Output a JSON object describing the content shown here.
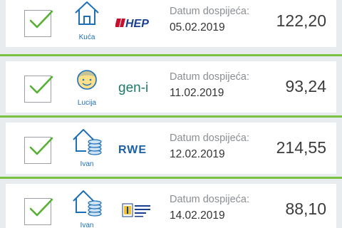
{
  "colors": {
    "divider": "#7cc242",
    "check": "#56b133",
    "accent_blue": "#1d6fb8",
    "hep_red": "#c8102e",
    "hep_blue": "#1b3f8f"
  },
  "bills": [
    {
      "category_icon": "house-icon",
      "category_label": "Kuća",
      "provider": "HEP",
      "provider_text": "HEP",
      "due_label": "Datum dospijeća:",
      "due_date": "05.02.2019",
      "amount": "122,20",
      "checked": true
    },
    {
      "category_icon": "person-face-icon",
      "category_label": "Lucija",
      "provider": "gen-i",
      "provider_text": "gen-i",
      "due_label": "Datum dospijeća:",
      "due_date": "11.02.2019",
      "amount": "93,24",
      "checked": true
    },
    {
      "category_icon": "house-coins-icon",
      "category_label": "Ivan",
      "provider": "RWE",
      "provider_text": "RWE",
      "due_label": "Datum dospijeća:",
      "due_date": "12.02.2019",
      "amount": "214,55",
      "checked": true
    },
    {
      "category_icon": "house-coins-icon",
      "category_label": "Ivan",
      "provider": "gradska-plinara-logo",
      "provider_text": "",
      "due_label": "Datum dospijeća:",
      "due_date": "14.02.2019",
      "amount": "88,10",
      "checked": true
    }
  ]
}
